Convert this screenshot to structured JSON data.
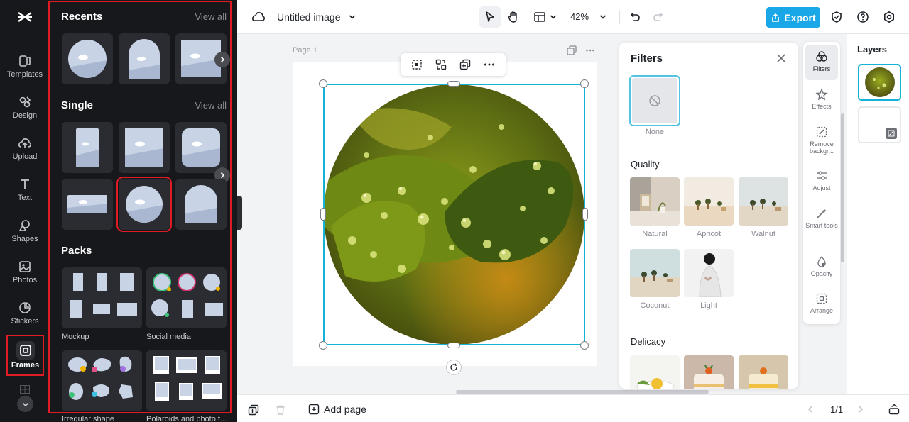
{
  "rail": {
    "items": [
      {
        "label": "Templates",
        "icon": "templates-icon"
      },
      {
        "label": "Design",
        "icon": "design-icon"
      },
      {
        "label": "Upload",
        "icon": "upload-icon"
      },
      {
        "label": "Text",
        "icon": "text-icon"
      },
      {
        "label": "Shapes",
        "icon": "shapes-icon"
      },
      {
        "label": "Photos",
        "icon": "photos-icon"
      },
      {
        "label": "Stickers",
        "icon": "stickers-icon"
      },
      {
        "label": "Frames",
        "icon": "frames-icon"
      }
    ],
    "active": "Frames"
  },
  "frames_panel": {
    "recents_title": "Recents",
    "single_title": "Single",
    "packs_title": "Packs",
    "view_all": "View all",
    "packs": [
      {
        "label": "Mockup"
      },
      {
        "label": "Social media"
      },
      {
        "label": "Irregular shape"
      },
      {
        "label": "Polaroids and photo f..."
      }
    ]
  },
  "topbar": {
    "doc_title": "Untitled image",
    "zoom": "42%",
    "export_label": "Export"
  },
  "canvas": {
    "page_label": "Page 1"
  },
  "filters": {
    "title": "Filters",
    "none_label": "None",
    "sections": [
      {
        "title": "Quality",
        "items": [
          "Natural",
          "Apricot",
          "Walnut",
          "Coconut",
          "Light"
        ]
      },
      {
        "title": "Delicacy",
        "items": []
      }
    ]
  },
  "tools": [
    {
      "label": "Filters",
      "icon": "filters-icon"
    },
    {
      "label": "Effects",
      "icon": "effects-icon"
    },
    {
      "label": "Remove backgr...",
      "icon": "remove-background-icon"
    },
    {
      "label": "Adjust",
      "icon": "adjust-icon"
    },
    {
      "label": "Smart tools",
      "icon": "smart-tools-icon"
    },
    {
      "label": "Opacity",
      "icon": "opacity-icon"
    },
    {
      "label": "Arrange",
      "icon": "arrange-icon"
    }
  ],
  "layers": {
    "title": "Layers"
  },
  "bottombar": {
    "add_page": "Add page",
    "pager": "1/1"
  },
  "colors": {
    "accent": "#1aa7e8",
    "selection": "#14b3d6",
    "highlight": "#e01b24",
    "panel_bg": "#17181b"
  }
}
